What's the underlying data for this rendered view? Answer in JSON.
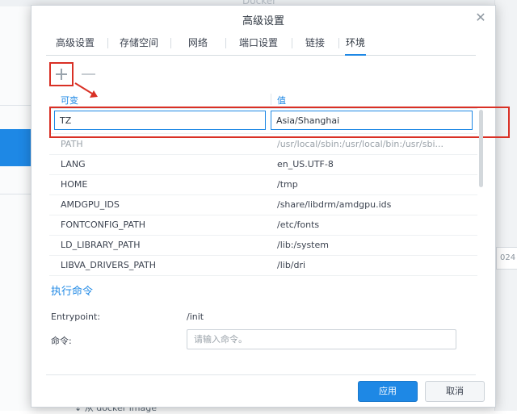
{
  "background": {
    "title": "Docker",
    "right_box_text": "024",
    "bottom_text": "↓ 从 docker image"
  },
  "dialog": {
    "title": "高级设置",
    "tabs": [
      {
        "label": "高级设置"
      },
      {
        "label": "存储空间"
      },
      {
        "label": "网络"
      },
      {
        "label": "端口设置"
      },
      {
        "label": "链接"
      },
      {
        "label": "环境",
        "active": true
      }
    ]
  },
  "env_table": {
    "header_variable": "可变",
    "header_value": "值",
    "editing_row": {
      "variable": "TZ",
      "value": "Asia/Shanghai"
    },
    "rows": [
      {
        "variable": "PATH",
        "value": "/usr/local/sbin:/usr/local/bin:/usr/sbi..."
      },
      {
        "variable": "LANG",
        "value": "en_US.UTF-8"
      },
      {
        "variable": "HOME",
        "value": "/tmp"
      },
      {
        "variable": "AMDGPU_IDS",
        "value": "/share/libdrm/amdgpu.ids"
      },
      {
        "variable": "FONTCONFIG_PATH",
        "value": "/etc/fonts"
      },
      {
        "variable": "LD_LIBRARY_PATH",
        "value": "/lib:/system"
      },
      {
        "variable": "LIBVA_DRIVERS_PATH",
        "value": "/lib/dri"
      }
    ]
  },
  "exec_section": {
    "title": "执行命令",
    "entrypoint_label": "Entrypoint:",
    "entrypoint_value": "/init",
    "command_label": "命令:",
    "command_placeholder": "请输入命令。",
    "command_value": ""
  },
  "footer": {
    "apply_label": "应用",
    "cancel_label": "取消"
  },
  "colors": {
    "accent": "#1e88e5",
    "highlight_annotation": "#d93025"
  }
}
